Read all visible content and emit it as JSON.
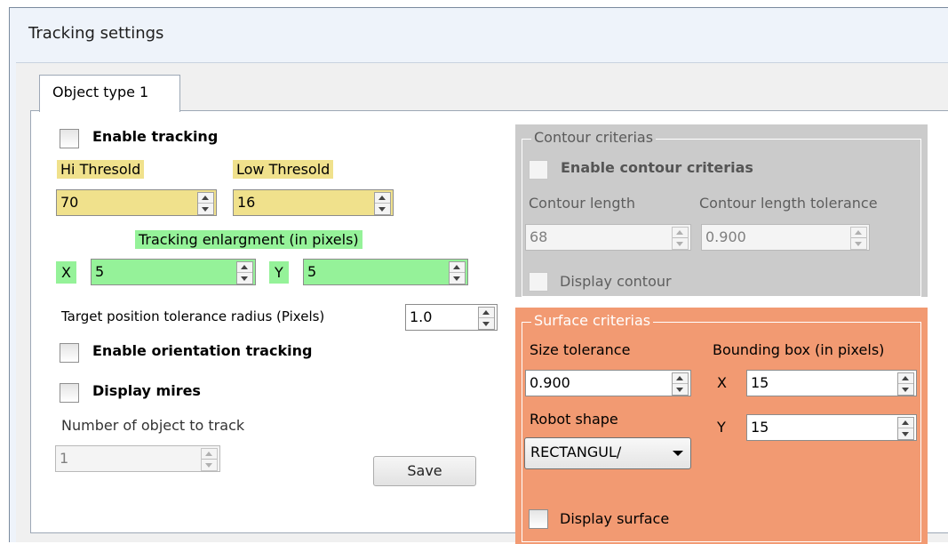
{
  "window": {
    "title": "Tracking settings"
  },
  "tabs": [
    {
      "label": "Object type 1"
    }
  ],
  "left": {
    "enable_tracking_label": "Enable tracking",
    "hi_threshold": {
      "label": "Hi Thresold",
      "value": "70"
    },
    "low_threshold": {
      "label": "Low Thresold",
      "value": "16"
    },
    "enlargment": {
      "label": "Tracking enlargment (in pixels)",
      "x_label": "X",
      "x_value": "5",
      "y_label": "Y",
      "y_value": "5"
    },
    "tolerance": {
      "label": "Target position tolerance radius (Pixels)",
      "value": "1.0"
    },
    "orientation_label": "Enable orientation tracking",
    "mires_label": "Display mires",
    "object_count": {
      "label": "Number of object to track",
      "value": "1"
    },
    "save_label": "Save"
  },
  "contour": {
    "legend": "Contour criterias",
    "enable_label": "Enable contour criterias",
    "length": {
      "label": "Contour length",
      "value": "68"
    },
    "length_tolerance": {
      "label": "Contour length tolerance",
      "value": "0.900"
    },
    "display_label": "Display contour"
  },
  "surface": {
    "legend": "Surface criterias",
    "size_tolerance": {
      "label": "Size tolerance",
      "value": "0.900"
    },
    "bounding_box": {
      "label": "Bounding box (in pixels)",
      "x_label": "X",
      "x_value": "15",
      "y_label": "Y",
      "y_value": "15"
    },
    "robot_shape": {
      "label": "Robot shape",
      "value": "RECTANGUL/"
    },
    "display_label": "Display surface"
  },
  "colors": {
    "threshold_highlight": "#f0e18c",
    "enlargment_highlight": "#95f299",
    "contour_group_bg": "#cbcbcb",
    "surface_group_bg": "#f29a72"
  }
}
